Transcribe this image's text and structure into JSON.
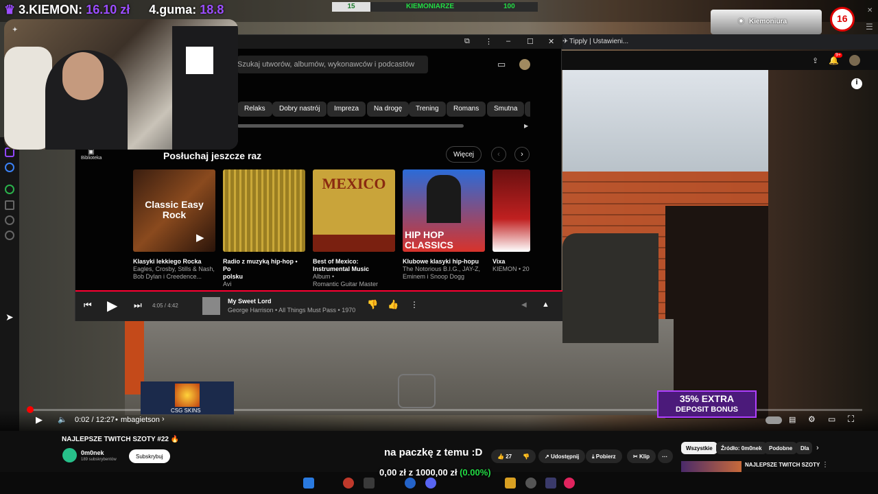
{
  "overlay": {
    "rank3": "3.KIEMON:",
    "rank3_amount": "16.10 zł",
    "rank4": "4.guma:",
    "rank4_amount": "18.8",
    "bar_left": "15",
    "bar_title": "KIEMONIARZE",
    "bar_right": "100",
    "channel_brand": "Kiemoniura",
    "caption": "na paczkę z temu :D",
    "donation_goal": "0,00 zł z 1000,00 zł",
    "donation_pct": "(0.00%)",
    "promo_line1": "35% EXTRA",
    "promo_line2": "DEPOSIT BONUS",
    "skins_label": "CSG SKINS"
  },
  "browser": {
    "tab_title": "Tipply | Ustawieni..."
  },
  "ytmusic": {
    "search_placeholder": "Szukaj utworów, albumów, wykonawców i podcastów",
    "library_label": "Biblioteka",
    "chips": [
      "Relaks",
      "Dobry nastrój",
      "Impreza",
      "Na drogę",
      "Trening",
      "Romans",
      "Smutna"
    ],
    "section_title": "Posłuchaj jeszcze raz",
    "more_label": "Więcej",
    "cards": [
      {
        "title": "Klasyki lekkiego Rocka",
        "sub1": "Eagles, Crosby, Stills & Nash,",
        "sub2": "Bob Dylan i Creedence...",
        "art": "Classic Easy Rock"
      },
      {
        "title": "Radio z muzyką hip-hop • Po",
        "sub1": "polsku",
        "sub2": "Avi",
        "art": ""
      },
      {
        "title": "Best of Mexico:",
        "sub1": "Instrumental Music",
        "sub2": "Album •",
        "sub3": "Romantic Guitar Master",
        "art": "MEXICO"
      },
      {
        "title": "Klubowe klasyki hip-hopu",
        "sub1": "The Notorious B.I.G., JAY-Z,",
        "sub2": "Eminem i Snoop Dogg",
        "art": "HIP HOP CLASSICS"
      },
      {
        "title": "Vixa",
        "sub1": "KIEMON • 20",
        "sub2": "",
        "art": ""
      }
    ],
    "player": {
      "time": "4:05 / 4:42",
      "song": "My Sweet Lord",
      "meta": "George Harrison • All Things Must Pass • 1970"
    }
  },
  "youtube": {
    "time": "0:02 / 12:27",
    "chapter": "mbagietson",
    "video_title": "NAJLEPSZE TWITCH SZOTY #22 🔥",
    "channel_name": "0m0nek",
    "subscribers": "189 subskrybentów",
    "subscribe": "Subskrybuj",
    "likes": "27",
    "share": "Udostępnij",
    "download": "Pobierz",
    "clip": "Klip",
    "rec_chips": [
      "Wszystkie",
      "Źródło: 0m0nek",
      "Podobne",
      "Dla"
    ],
    "rec_title": "NAJLEPSZE TWITCH SZOTY",
    "notif_count": "9+"
  },
  "colors": {
    "accent_red": "#ff0000",
    "rank_purple": "#9b4dff",
    "green": "#22dd44"
  }
}
